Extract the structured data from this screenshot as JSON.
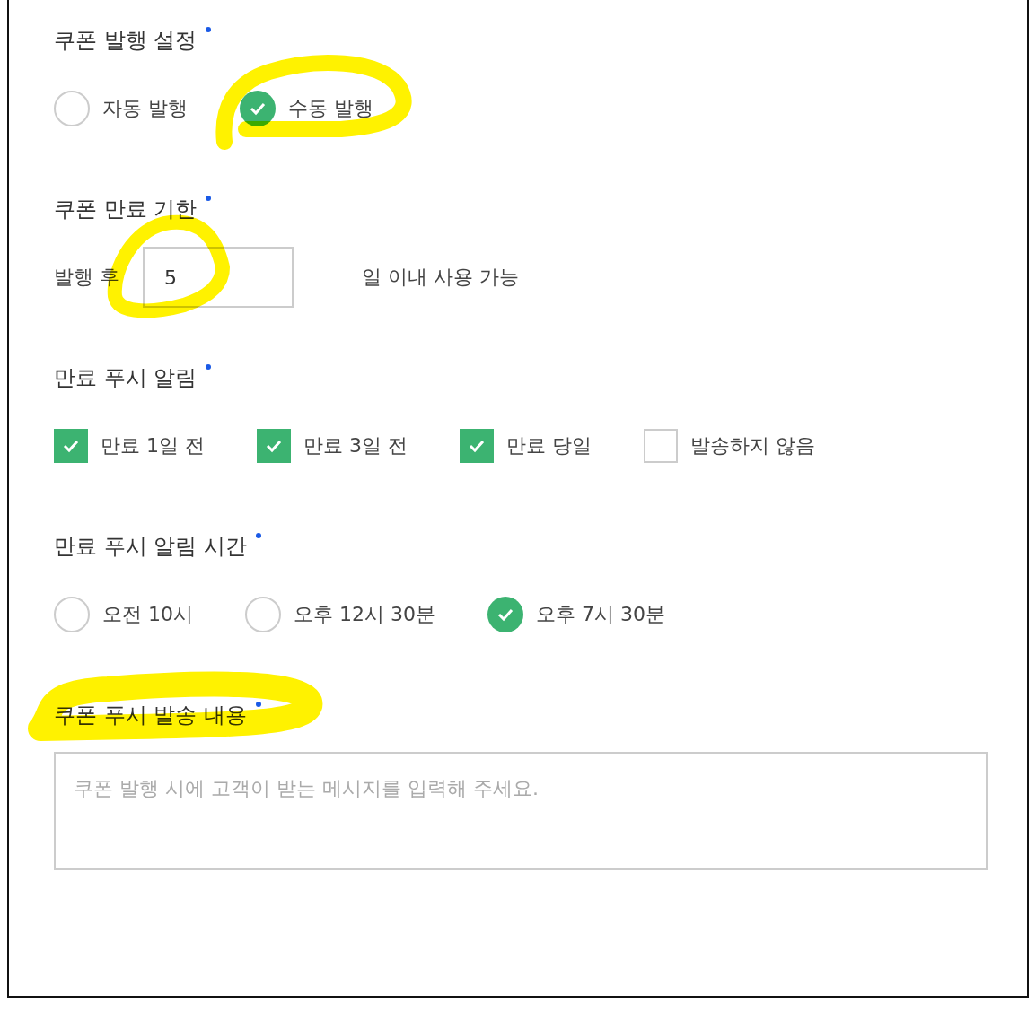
{
  "sections": [
    {
      "kind": "radio",
      "title": "쿠폰 발행 설정",
      "required": true,
      "options": [
        {
          "label": "자동 발행",
          "selected": false
        },
        {
          "label": "수동 발행",
          "selected": true
        }
      ]
    },
    {
      "kind": "days",
      "title": "쿠폰 만료 기한",
      "required": true,
      "prefix": "발행 후",
      "value": "5",
      "suffix": "일 이내 사용 가능"
    },
    {
      "kind": "checkbox",
      "title": "만료 푸시 알림",
      "required": true,
      "options": [
        {
          "label": "만료 1일 전",
          "checked": true
        },
        {
          "label": "만료 3일 전",
          "checked": true
        },
        {
          "label": "만료 당일",
          "checked": true
        },
        {
          "label": "발송하지 않음",
          "checked": false
        }
      ]
    },
    {
      "kind": "radio",
      "title": "만료 푸시 알림 시간",
      "required": true,
      "options": [
        {
          "label": "오전 10시",
          "selected": false
        },
        {
          "label": "오후 12시 30분",
          "selected": false
        },
        {
          "label": "오후 7시 30분",
          "selected": true
        }
      ]
    },
    {
      "kind": "textarea",
      "title": "쿠폰 푸시 발송 내용",
      "required": true,
      "placeholder": "쿠폰 발행 시에 고객이 받는 메시지를 입력해 주세요."
    }
  ]
}
